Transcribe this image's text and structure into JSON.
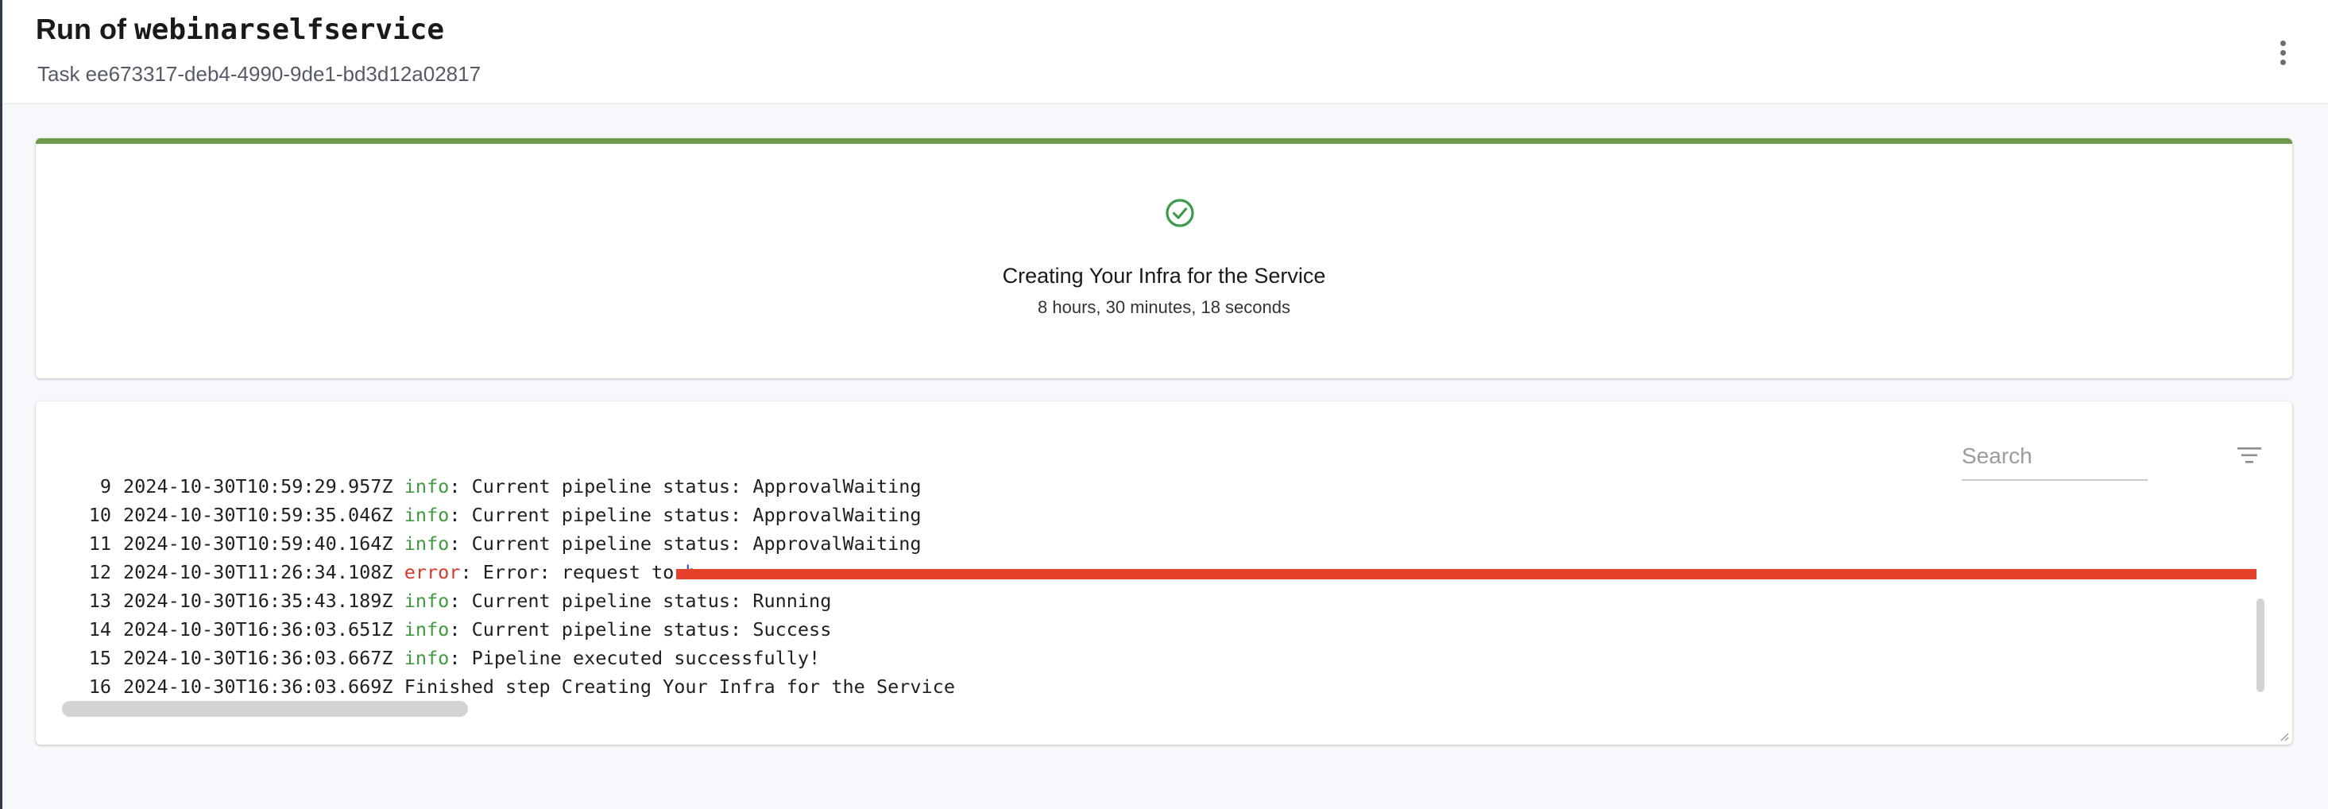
{
  "header": {
    "title_prefix": "Run of ",
    "title_entity": "webinarselfservice",
    "subtitle": "Task ee673317-deb4-4990-9de1-bd3d12a02817"
  },
  "step": {
    "status_icon": "check-circle-icon",
    "title": "Creating Your Infra for the Service",
    "duration": "8 hours, 30 minutes, 18 seconds",
    "accent_color": "#6e9a4c"
  },
  "log": {
    "search_placeholder": "Search",
    "filter_icon": "filter-icon",
    "lines": [
      {
        "num": "9",
        "timestamp": "2024-10-30T10:59:29.957Z",
        "level": "info",
        "message": ": Current pipeline status: ApprovalWaiting"
      },
      {
        "num": "10",
        "timestamp": "2024-10-30T10:59:35.046Z",
        "level": "info",
        "message": ": Current pipeline status: ApprovalWaiting"
      },
      {
        "num": "11",
        "timestamp": "2024-10-30T10:59:40.164Z",
        "level": "info",
        "message": ": Current pipeline status: ApprovalWaiting"
      },
      {
        "num": "12",
        "timestamp": "2024-10-30T11:26:34.108Z",
        "level": "error",
        "message": ": Error: request to ",
        "url": "h"
      },
      {
        "num": "13",
        "timestamp": "2024-10-30T16:35:43.189Z",
        "level": "info",
        "message": ": Current pipeline status: Running"
      },
      {
        "num": "14",
        "timestamp": "2024-10-30T16:36:03.651Z",
        "level": "info",
        "message": ": Current pipeline status: Success"
      },
      {
        "num": "15",
        "timestamp": "2024-10-30T16:36:03.667Z",
        "level": "info",
        "message": ": Pipeline executed successfully!"
      },
      {
        "num": "16",
        "timestamp": "2024-10-30T16:36:03.669Z",
        "level": "",
        "message": "Finished step Creating Your Infra for the Service"
      }
    ]
  }
}
